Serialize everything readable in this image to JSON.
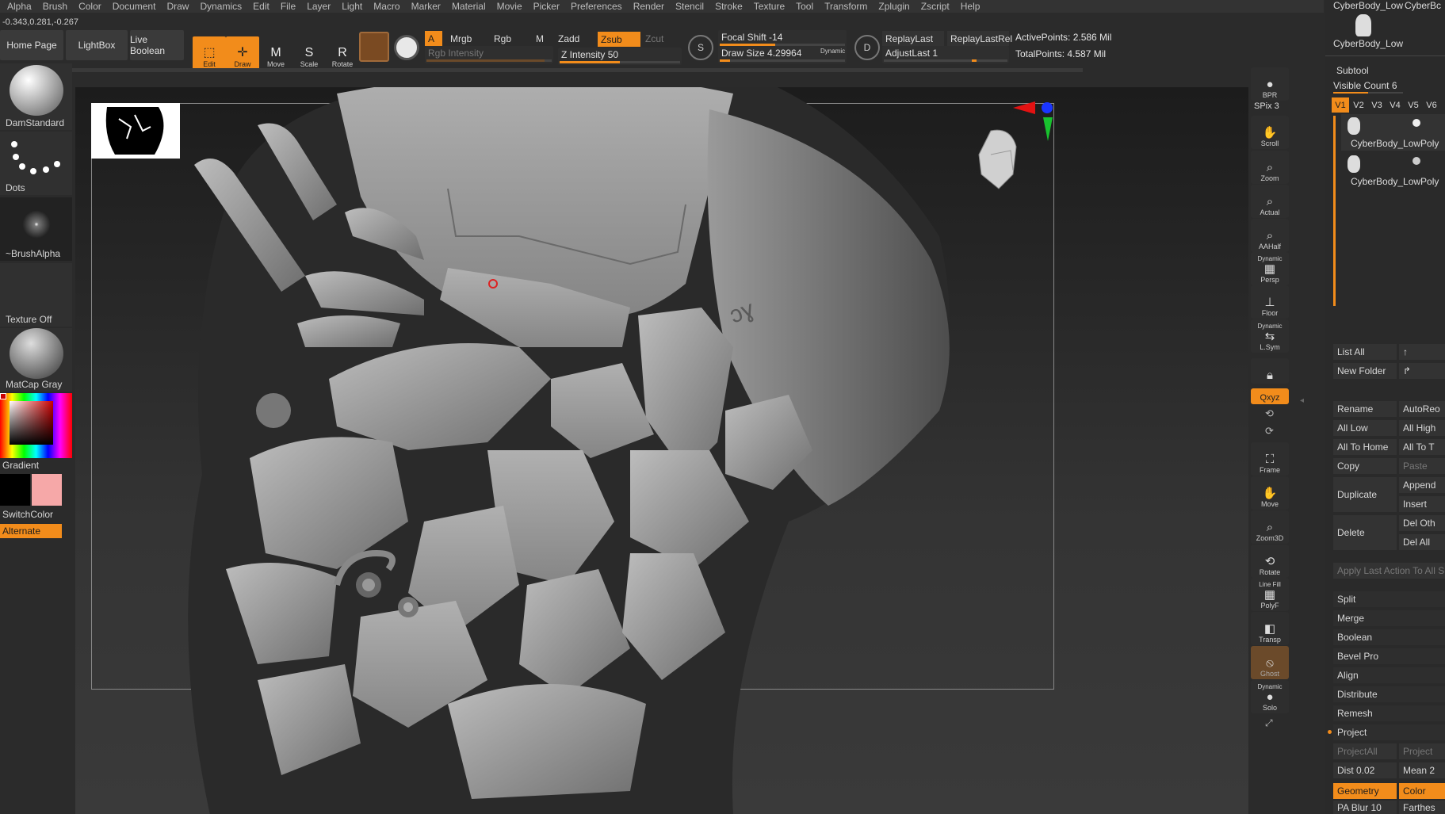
{
  "menu": [
    "Alpha",
    "Brush",
    "Color",
    "Document",
    "Draw",
    "Dynamics",
    "Edit",
    "File",
    "Layer",
    "Light",
    "Macro",
    "Marker",
    "Material",
    "Movie",
    "Picker",
    "Preferences",
    "Render",
    "Stencil",
    "Stroke",
    "Texture",
    "Tool",
    "Transform",
    "Zplugin",
    "Zscript",
    "Help"
  ],
  "coords": "-0.343,0.281,-0.267",
  "top": {
    "home": "Home Page",
    "lightbox": "LightBox",
    "liveboolean": "Live Boolean",
    "edit": "Edit",
    "draw": "Draw",
    "move": "Move",
    "scale": "Scale",
    "rotate": "Rotate",
    "a": "A",
    "mrgb": "Mrgb",
    "rgb": "Rgb",
    "m": "M",
    "zadd": "Zadd",
    "zsub": "Zsub",
    "zcut": "Zcut",
    "rgb_intensity": "Rgb Intensity",
    "z_intensity": "Z Intensity 50",
    "focal_shift": "Focal Shift -14",
    "draw_size": "Draw Size 4.29964",
    "dynamic": "Dynamic",
    "replay_last": "ReplayLast",
    "replay_last_rel": "ReplayLastRel",
    "adjust_last": "AdjustLast 1",
    "active_points": "ActivePoints: 2.586 Mil",
    "total_points": "TotalPoints: 4.587 Mil",
    "s_label": "S",
    "d_label": "D"
  },
  "left": {
    "brush": "DamStandard",
    "stroke": "Dots",
    "alpha": "~BrushAlpha",
    "texture": "Texture Off",
    "material": "MatCap Gray",
    "gradient": "Gradient",
    "switchcolor": "SwitchColor",
    "alternate": "Alternate"
  },
  "right_dock": {
    "bpr": "BPR",
    "spix": "SPix 3",
    "scroll": "Scroll",
    "zoom": "Zoom",
    "actual": "Actual",
    "aahalf": "AAHalf",
    "dynamic": "Dynamic",
    "persp": "Persp",
    "floor": "Floor",
    "lsym_dyn": "Dynamic",
    "lsym": "L.Sym",
    "xyz": "Qxyz",
    "frame": "Frame",
    "move": "Move",
    "zoom3d": "Zoom3D",
    "rotate": "Rotate",
    "linefill": "Line Fill",
    "polyf": "PolyF",
    "transp": "Transp",
    "ghost": "Ghost",
    "solo_dyn": "Dynamic",
    "solo": "Solo"
  },
  "subtool": {
    "top1": "CyberBody_LowF",
    "top2": "CyberBc",
    "top3": "CyberBody_LowF",
    "title": "Subtool",
    "visible_count": "Visible Count 6",
    "tabs": [
      "V1",
      "V2",
      "V3",
      "V4",
      "V5",
      "V6"
    ],
    "items": [
      "CyberBody_LowPoly",
      "CyberBody_LowPoly"
    ],
    "list_all": "List All",
    "new_folder": "New Folder",
    "rename": "Rename",
    "autoreorder": "AutoReo",
    "all_low": "All Low",
    "all_high": "All High",
    "all_to_home": "All To Home",
    "all_to": "All To T",
    "copy": "Copy",
    "paste": "Paste",
    "duplicate": "Duplicate",
    "append": "Append",
    "insert": "Insert",
    "delete": "Delete",
    "del_other": "Del Oth",
    "del_all": "Del All",
    "apply_last": "Apply Last Action To All S",
    "split": "Split",
    "merge": "Merge",
    "boolean": "Boolean",
    "bevel_pro": "Bevel Pro",
    "align": "Align",
    "distribute": "Distribute",
    "remesh": "Remesh",
    "project": "Project",
    "project_all": "ProjectAll",
    "project_b": "Project",
    "dist": "Dist 0.02",
    "mean": "Mean 2",
    "geometry": "Geometry",
    "color": "Color",
    "pa_blur": "PA Blur 10",
    "farthest": "Farthes"
  }
}
